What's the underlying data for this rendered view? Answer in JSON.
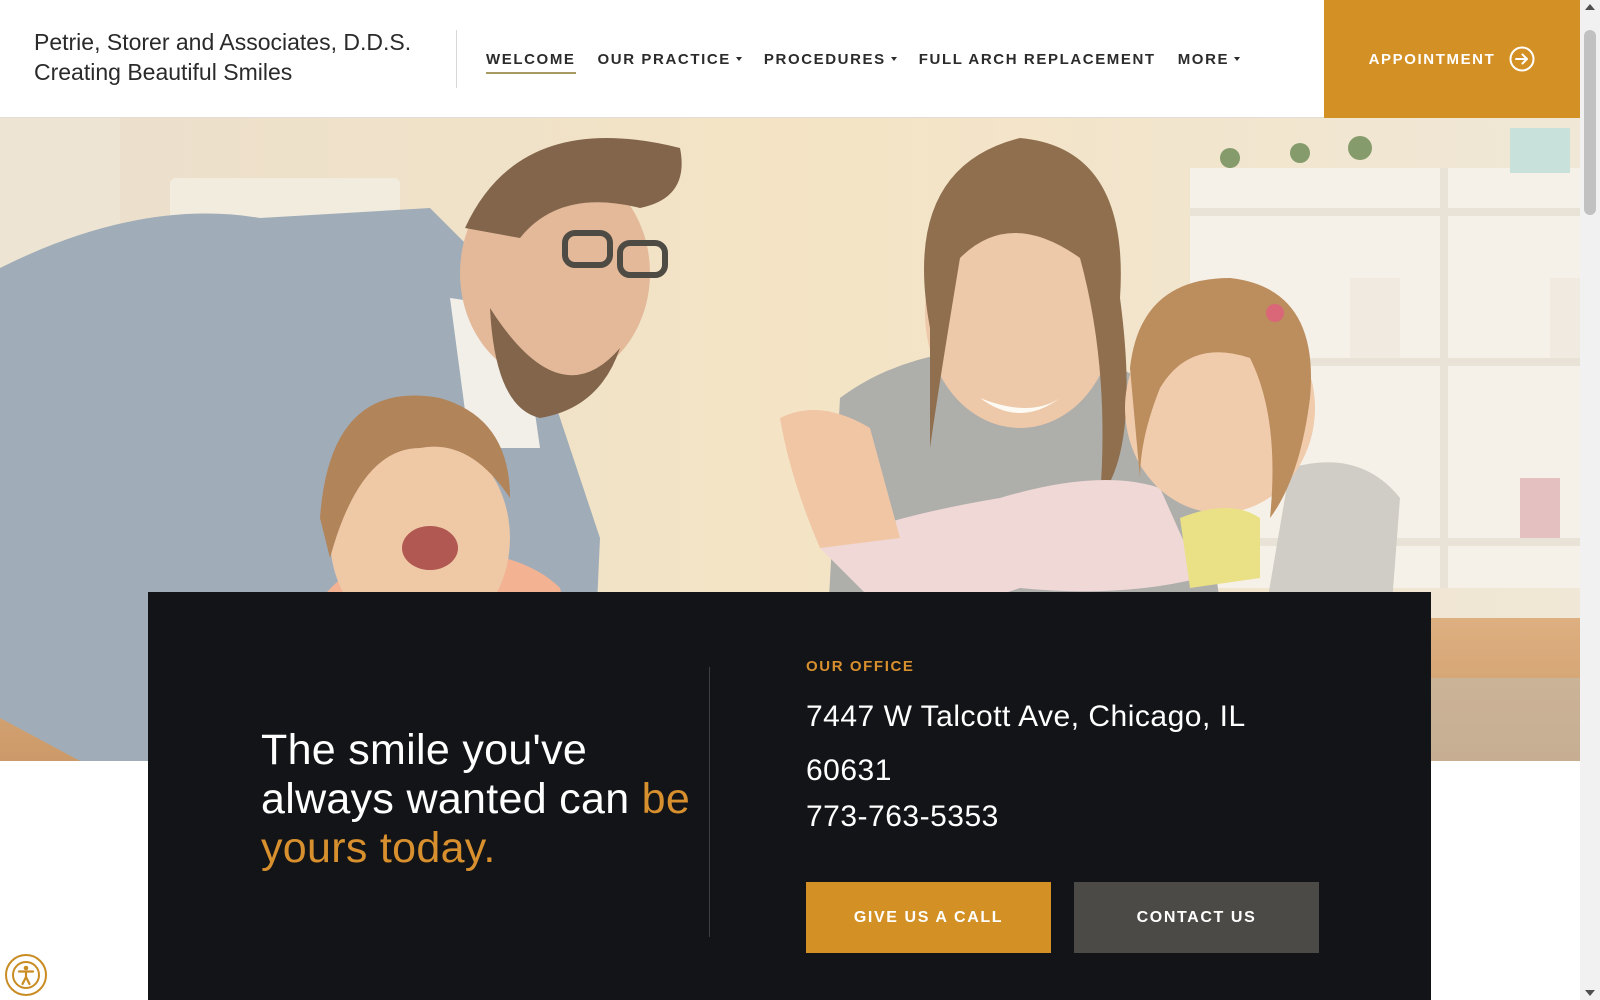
{
  "brand": {
    "line1": "Petrie, Storer and Associates, D.D.S.",
    "line2": "Creating Beautiful Smiles"
  },
  "nav": {
    "items": [
      {
        "label": "WELCOME",
        "active": true,
        "dropdown": false
      },
      {
        "label": "OUR PRACTICE",
        "active": false,
        "dropdown": true
      },
      {
        "label": "PROCEDURES",
        "active": false,
        "dropdown": true
      },
      {
        "label": "FULL ARCH REPLACEMENT",
        "active": false,
        "dropdown": false
      },
      {
        "label": "MORE",
        "active": false,
        "dropdown": true
      }
    ],
    "appointment_label": "APPOINTMENT",
    "appointment_icon": "arrow-circle-right-icon"
  },
  "hero": {
    "image": "family-laughing-photo"
  },
  "info": {
    "tagline_part1": "The smile you've always wanted can ",
    "tagline_accent": "be yours today.",
    "office_label": "OUR OFFICE",
    "address": "7447 W Talcott Ave, Chicago, IL 60631",
    "phone": "773-763-5353",
    "call_button": "GIVE US A CALL",
    "contact_button": "CONTACT US"
  },
  "accessibility": {
    "icon": "accessibility-icon"
  },
  "colors": {
    "accent": "#d39024",
    "dark_panel": "#131417",
    "contact_button": "#4b4a47",
    "nav_underline": "#a89a63"
  }
}
